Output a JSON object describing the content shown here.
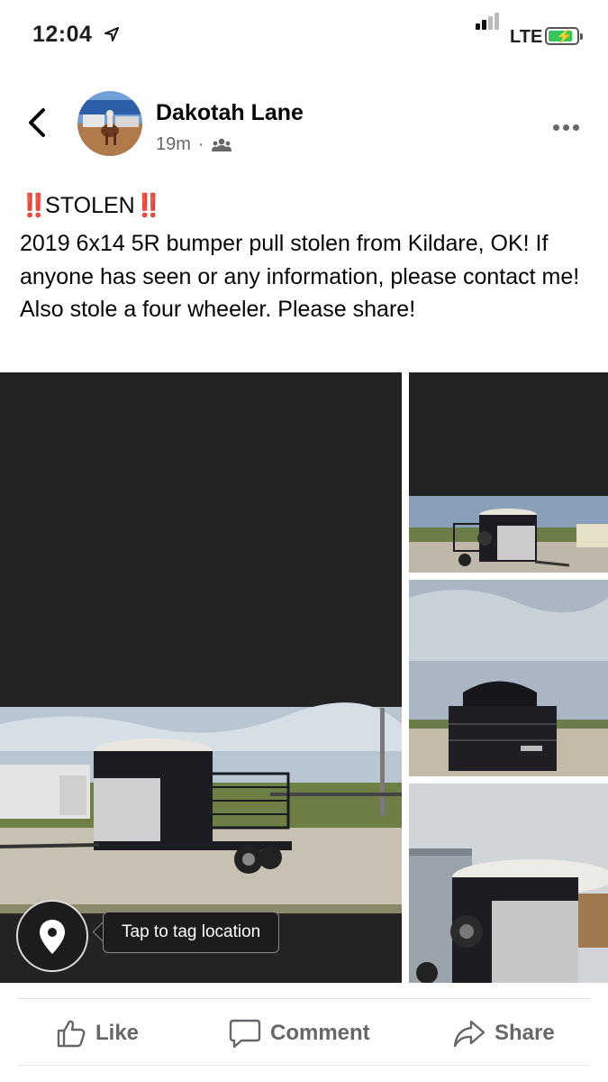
{
  "status_bar": {
    "time": "12:04",
    "network": "LTE",
    "battery_charging": true
  },
  "post": {
    "author": "Dakotah Lane",
    "time_ago": "19m",
    "audience_icon": "friends-icon",
    "title_prefix": "‼️",
    "title": "STOLEN",
    "title_suffix": "‼️",
    "body": "2019 6x14 5R bumper pull stolen from Kildare, OK! If anyone has seen or any information, please contact me! Also stole a four wheeler. Please share!"
  },
  "photos": {
    "count": 4,
    "location_tooltip": "Tap to tag location"
  },
  "actions": {
    "like": "Like",
    "comment": "Comment",
    "share": "Share"
  },
  "colors": {
    "text_primary": "#050505",
    "text_secondary": "#65676b",
    "stolen_emoji_red": "#e0301e",
    "photo_dark": "#232325",
    "battery_green": "#35c759"
  }
}
